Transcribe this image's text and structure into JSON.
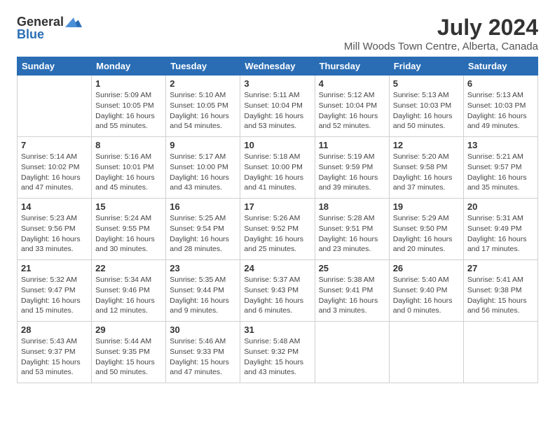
{
  "logo": {
    "general": "General",
    "blue": "Blue"
  },
  "title": "July 2024",
  "subtitle": "Mill Woods Town Centre, Alberta, Canada",
  "days_of_week": [
    "Sunday",
    "Monday",
    "Tuesday",
    "Wednesday",
    "Thursday",
    "Friday",
    "Saturday"
  ],
  "weeks": [
    [
      {
        "day": "",
        "info": ""
      },
      {
        "day": "1",
        "info": "Sunrise: 5:09 AM\nSunset: 10:05 PM\nDaylight: 16 hours\nand 55 minutes."
      },
      {
        "day": "2",
        "info": "Sunrise: 5:10 AM\nSunset: 10:05 PM\nDaylight: 16 hours\nand 54 minutes."
      },
      {
        "day": "3",
        "info": "Sunrise: 5:11 AM\nSunset: 10:04 PM\nDaylight: 16 hours\nand 53 minutes."
      },
      {
        "day": "4",
        "info": "Sunrise: 5:12 AM\nSunset: 10:04 PM\nDaylight: 16 hours\nand 52 minutes."
      },
      {
        "day": "5",
        "info": "Sunrise: 5:13 AM\nSunset: 10:03 PM\nDaylight: 16 hours\nand 50 minutes."
      },
      {
        "day": "6",
        "info": "Sunrise: 5:13 AM\nSunset: 10:03 PM\nDaylight: 16 hours\nand 49 minutes."
      }
    ],
    [
      {
        "day": "7",
        "info": "Sunrise: 5:14 AM\nSunset: 10:02 PM\nDaylight: 16 hours\nand 47 minutes."
      },
      {
        "day": "8",
        "info": "Sunrise: 5:16 AM\nSunset: 10:01 PM\nDaylight: 16 hours\nand 45 minutes."
      },
      {
        "day": "9",
        "info": "Sunrise: 5:17 AM\nSunset: 10:00 PM\nDaylight: 16 hours\nand 43 minutes."
      },
      {
        "day": "10",
        "info": "Sunrise: 5:18 AM\nSunset: 10:00 PM\nDaylight: 16 hours\nand 41 minutes."
      },
      {
        "day": "11",
        "info": "Sunrise: 5:19 AM\nSunset: 9:59 PM\nDaylight: 16 hours\nand 39 minutes."
      },
      {
        "day": "12",
        "info": "Sunrise: 5:20 AM\nSunset: 9:58 PM\nDaylight: 16 hours\nand 37 minutes."
      },
      {
        "day": "13",
        "info": "Sunrise: 5:21 AM\nSunset: 9:57 PM\nDaylight: 16 hours\nand 35 minutes."
      }
    ],
    [
      {
        "day": "14",
        "info": "Sunrise: 5:23 AM\nSunset: 9:56 PM\nDaylight: 16 hours\nand 33 minutes."
      },
      {
        "day": "15",
        "info": "Sunrise: 5:24 AM\nSunset: 9:55 PM\nDaylight: 16 hours\nand 30 minutes."
      },
      {
        "day": "16",
        "info": "Sunrise: 5:25 AM\nSunset: 9:54 PM\nDaylight: 16 hours\nand 28 minutes."
      },
      {
        "day": "17",
        "info": "Sunrise: 5:26 AM\nSunset: 9:52 PM\nDaylight: 16 hours\nand 25 minutes."
      },
      {
        "day": "18",
        "info": "Sunrise: 5:28 AM\nSunset: 9:51 PM\nDaylight: 16 hours\nand 23 minutes."
      },
      {
        "day": "19",
        "info": "Sunrise: 5:29 AM\nSunset: 9:50 PM\nDaylight: 16 hours\nand 20 minutes."
      },
      {
        "day": "20",
        "info": "Sunrise: 5:31 AM\nSunset: 9:49 PM\nDaylight: 16 hours\nand 17 minutes."
      }
    ],
    [
      {
        "day": "21",
        "info": "Sunrise: 5:32 AM\nSunset: 9:47 PM\nDaylight: 16 hours\nand 15 minutes."
      },
      {
        "day": "22",
        "info": "Sunrise: 5:34 AM\nSunset: 9:46 PM\nDaylight: 16 hours\nand 12 minutes."
      },
      {
        "day": "23",
        "info": "Sunrise: 5:35 AM\nSunset: 9:44 PM\nDaylight: 16 hours\nand 9 minutes."
      },
      {
        "day": "24",
        "info": "Sunrise: 5:37 AM\nSunset: 9:43 PM\nDaylight: 16 hours\nand 6 minutes."
      },
      {
        "day": "25",
        "info": "Sunrise: 5:38 AM\nSunset: 9:41 PM\nDaylight: 16 hours\nand 3 minutes."
      },
      {
        "day": "26",
        "info": "Sunrise: 5:40 AM\nSunset: 9:40 PM\nDaylight: 16 hours\nand 0 minutes."
      },
      {
        "day": "27",
        "info": "Sunrise: 5:41 AM\nSunset: 9:38 PM\nDaylight: 15 hours\nand 56 minutes."
      }
    ],
    [
      {
        "day": "28",
        "info": "Sunrise: 5:43 AM\nSunset: 9:37 PM\nDaylight: 15 hours\nand 53 minutes."
      },
      {
        "day": "29",
        "info": "Sunrise: 5:44 AM\nSunset: 9:35 PM\nDaylight: 15 hours\nand 50 minutes."
      },
      {
        "day": "30",
        "info": "Sunrise: 5:46 AM\nSunset: 9:33 PM\nDaylight: 15 hours\nand 47 minutes."
      },
      {
        "day": "31",
        "info": "Sunrise: 5:48 AM\nSunset: 9:32 PM\nDaylight: 15 hours\nand 43 minutes."
      },
      {
        "day": "",
        "info": ""
      },
      {
        "day": "",
        "info": ""
      },
      {
        "day": "",
        "info": ""
      }
    ]
  ]
}
